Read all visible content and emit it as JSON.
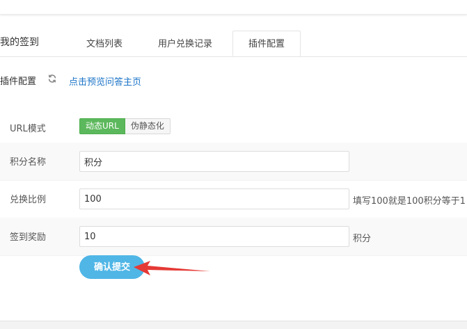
{
  "section": {
    "title": "我的签到"
  },
  "tabs": [
    {
      "label": "文档列表"
    },
    {
      "label": "用户兑换记录"
    },
    {
      "label": "插件配置"
    }
  ],
  "subheader": {
    "title": "插件配置",
    "refresh_icon": "refresh-icon",
    "preview_link": "点击预览问答主页"
  },
  "form": {
    "url_mode": {
      "label": "URL模式",
      "options": [
        "动态URL",
        "伪静态化"
      ],
      "selected": "动态URL"
    },
    "points_name": {
      "label": "积分名称",
      "value": "积分"
    },
    "exchange_ratio": {
      "label": "兑换比例",
      "value": "100",
      "hint": "填写100就是100积分等于1"
    },
    "checkin_reward": {
      "label": "签到奖励",
      "value": "10",
      "unit": "积分"
    },
    "submit_label": "确认提交"
  },
  "colors": {
    "toggle_active": "#5cb85c",
    "submit_button": "#4fb6e6",
    "link": "#1a73c7",
    "annotation_arrow": "#e53935"
  }
}
